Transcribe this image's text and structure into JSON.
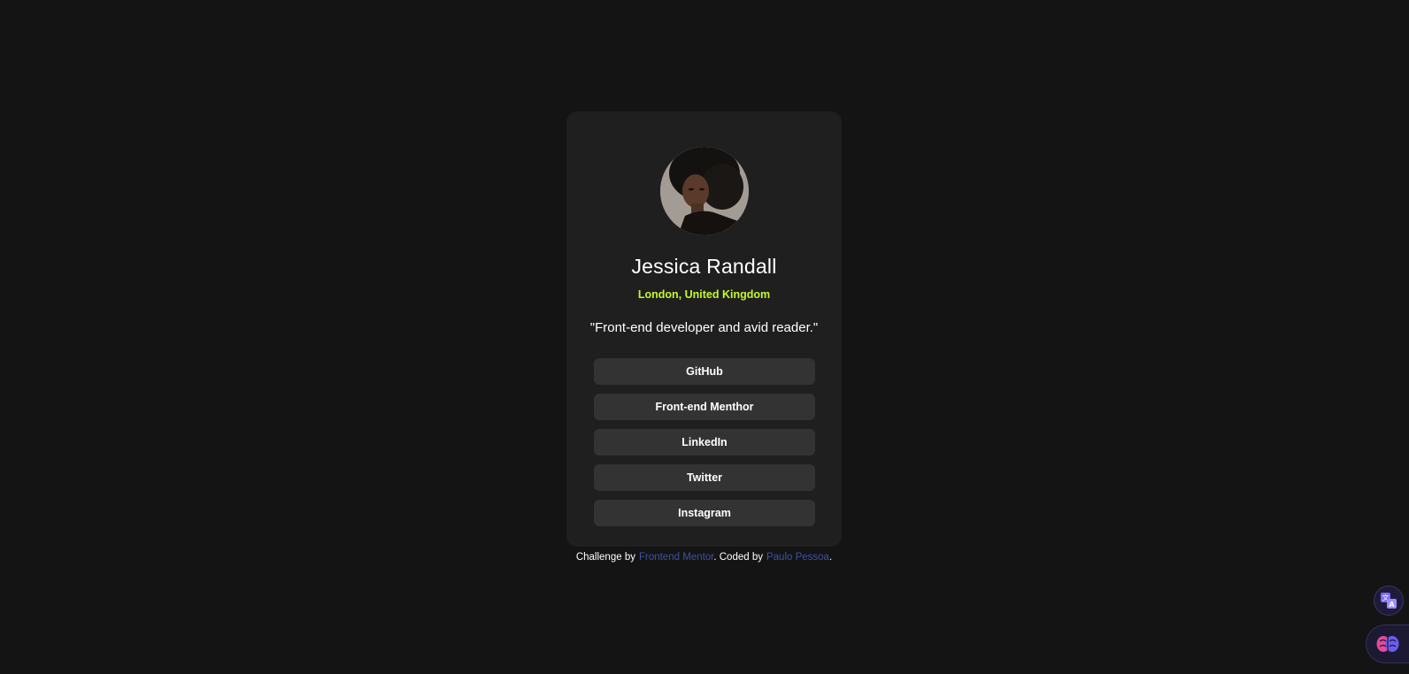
{
  "profile": {
    "name": "Jessica Randall",
    "location": "London, United Kingdom",
    "bio": "\"Front-end developer and avid reader.\""
  },
  "links": [
    {
      "label": "GitHub"
    },
    {
      "label": "Front-end Menthor"
    },
    {
      "label": "LinkedIn"
    },
    {
      "label": "Twitter"
    },
    {
      "label": "Instagram"
    }
  ],
  "footer": {
    "prefix": "Challenge by",
    "challenge_link": "Frontend Mentor",
    "middle": ". Coded by",
    "author_link": "Paulo Pessoa",
    "suffix": "."
  },
  "floating_buttons": {
    "translate_icon": "translate-icon",
    "brain_icon": "brain-icon"
  },
  "colors": {
    "background": "#141414",
    "card": "#1f1f1f",
    "button": "#333333",
    "accent_green": "#c4f82a",
    "link_blue": "#3e52a3"
  }
}
